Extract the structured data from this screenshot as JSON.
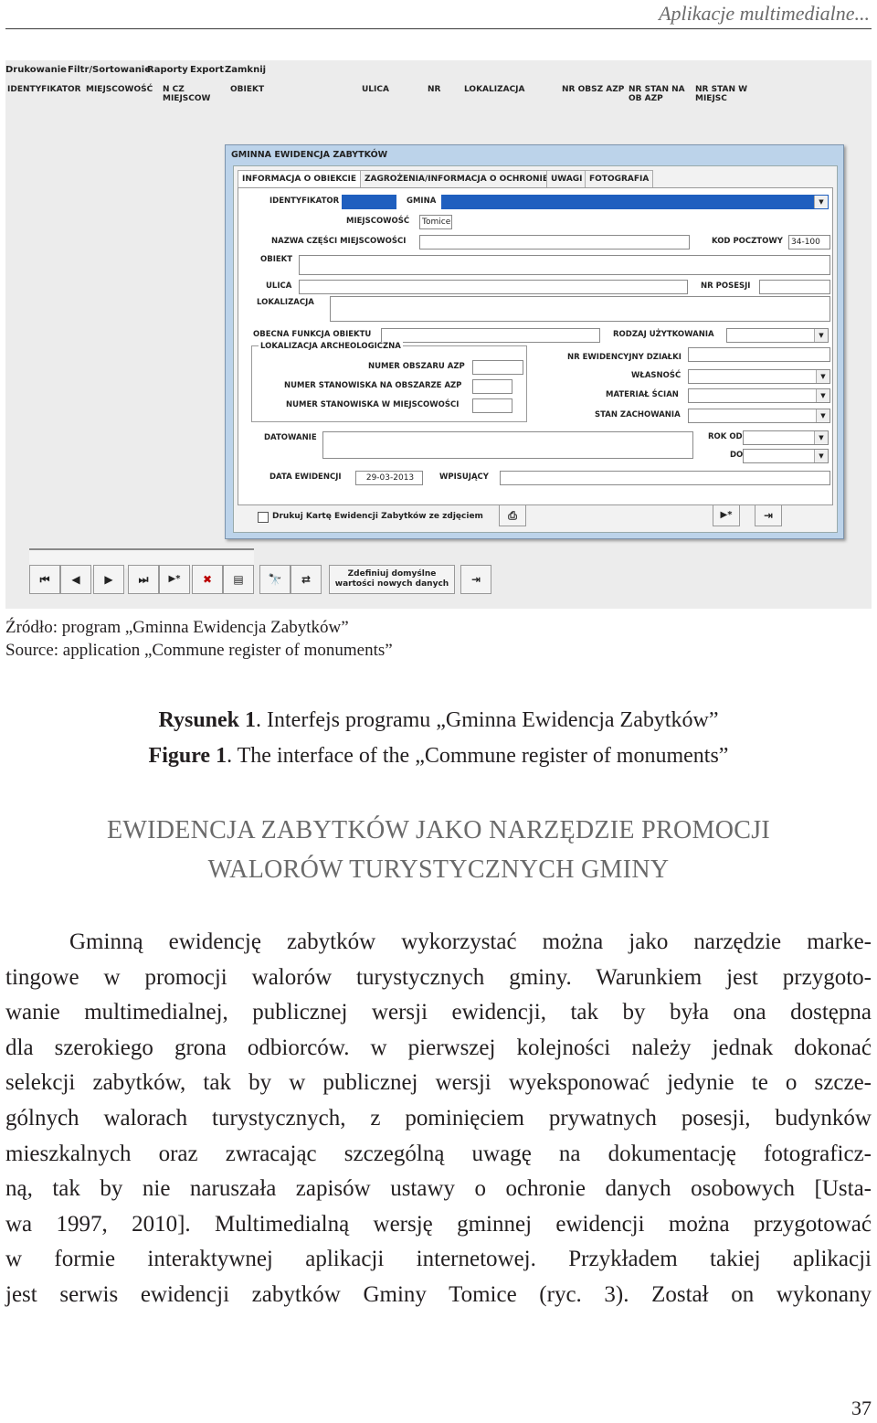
{
  "running_header": "Aplikacje multimedialne...",
  "screenshot": {
    "menu": [
      "Drukowanie",
      "Filtr/Sortowanie",
      "Raporty",
      "Export",
      "Zamknij"
    ],
    "columns": [
      "IDENTYFIKATOR",
      "MIEJSCOWOŚĆ",
      "N CZ MIEJSCOW",
      "OBIEKT",
      "ULICA",
      "NR",
      "LOKALIZACJA",
      "NR OBSZ AZP",
      "NR STAN NA OB AZP",
      "NR STAN W MIEJSC"
    ],
    "dialog_title": "GMINNA EWIDENCJA ZABYTKÓW",
    "tabs": [
      "INFORMACJA O OBIEKCIE",
      "ZAGROŻENIA/INFORMACJA O OCHRONIE",
      "UWAGI",
      "FOTOGRAFIA"
    ],
    "labels": {
      "identyfikator": "IDENTYFIKATOR",
      "gmina": "GMINA",
      "miejscowosc": "MIEJSCOWOŚĆ",
      "nazwa_czesci": "NAZWA CZĘŚCI MIEJSCOWOŚCI",
      "kod_pocztowy": "KOD POCZTOWY",
      "obiekt": "OBIEKT",
      "ulica": "ULICA",
      "nr_posesji": "NR POSESJI",
      "lokalizacja": "LOKALIZACJA",
      "obecna_funkcja": "OBECNA FUNKCJA OBIEKTU",
      "rodzaj_uzytkowania": "RODZAJ UŻYTKOWANIA",
      "lokalizacja_arch": "LOKALIZACJA ARCHEOLOGICZNA",
      "numer_obszaru": "NUMER OBSZARU AZP",
      "numer_stanowiska_azp": "NUMER STANOWISKA NA OBSZARZE AZP",
      "numer_stanowiska_miejsc": "NUMER STANOWISKA W MIEJSCOWOŚCI",
      "nr_ewid_dzialki": "NR EWIDENCYJNY DZIAŁKI",
      "wlasnosc": "WŁASNOŚĆ",
      "material_scian": "MATERIAŁ ŚCIAN",
      "stan_zachowania": "STAN ZACHOWANIA",
      "datowanie": "DATOWANIE",
      "rok_od": "ROK OD",
      "do": "DO",
      "data_ewidencji": "DATA EWIDENCJI",
      "wpisujacy": "WPISUJĄCY"
    },
    "values": {
      "miejscowosc": "Tomice",
      "kod_pocztowy": "34-100",
      "data_ewidencji": "29-03-2013"
    },
    "print_checkbox_label": "Drukuj Kartę Ewidencji Zabytków ze zdjęciem",
    "define_defaults_button": "Zdefiniuj domyślne wartości nowych danych",
    "nav_buttons": [
      "⏮",
      "◀",
      "▶",
      "⏭",
      "▶*",
      "✖",
      "▤",
      "🔭",
      "⇄"
    ]
  },
  "captions": {
    "source_pl": "Źródło: program „Gminna Ewidencja Zabytków”",
    "source_en": "Source: application „Commune register of monuments”",
    "figure_pl_label": "Rysunek 1",
    "figure_pl_text": ". Interfejs programu „Gminna Ewidencja Zabytków”",
    "figure_en_label": "Figure 1",
    "figure_en_text": ". The interface of the „Commune register of monuments”"
  },
  "section_title": [
    "EWIDENCJA ZABYTKÓW JAKO NARZĘDZIE PROMOCJI",
    "WALORÓW TURYSTYCZNYCH GMINY"
  ],
  "body_lines": [
    "Gminną ewidencję zabytków wykorzystać można jako narzędzie marke-",
    "tingowe w promocji walorów turystycznych gminy. Warunkiem jest przygoto-",
    "wanie multimedialnej, publicznej wersji ewidencji, tak by była ona dostępna",
    "dla szerokiego grona odbiorców. w pierwszej kolejności należy jednak dokonać",
    "selekcji zabytków, tak by w publicznej wersji wyeksponować jedynie te o szcze-",
    "gólnych walorach turystycznych, z pominięciem prywatnych posesji, budynków",
    "mieszkalnych oraz zwracając szczególną uwagę na dokumentację fotograficz-",
    "ną, tak by nie naruszała zapisów ustawy o ochronie danych osobowych [Usta-",
    "wa 1997, 2010]. Multimedialną wersję gminnej ewidencji można przygotować",
    "w formie interaktywnej aplikacji internetowej. Przykładem takiej aplikacji",
    "jest serwis ewidencji zabytków Gminy Tomice (ryc. 3). Został on wykonany"
  ],
  "page_number": "37"
}
